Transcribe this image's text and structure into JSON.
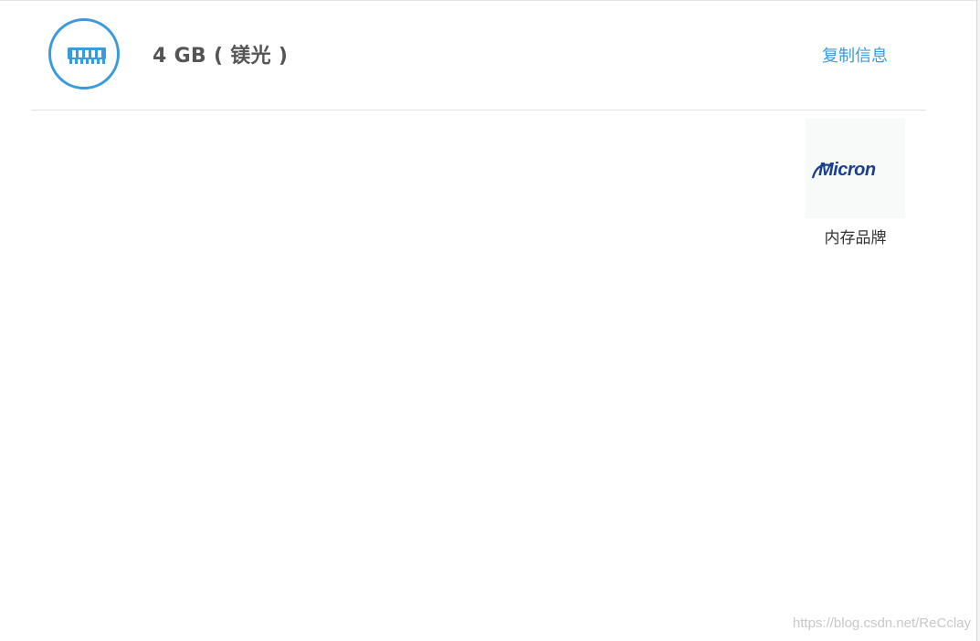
{
  "memory": {
    "title": "4 GB ( 镁光 )",
    "copy_label": "复制信息",
    "icon": "memory-module-icon"
  },
  "brand": {
    "logo_name": "micron-logo",
    "logo_text": "Micron",
    "caption": "内存品牌",
    "logo_color": "#1b3f8f"
  },
  "watermark": {
    "text": "https://blog.csdn.net/ReCclay"
  },
  "colors": {
    "accent": "#3a9bdc",
    "title": "#555555",
    "divider": "#e3e3e3"
  }
}
